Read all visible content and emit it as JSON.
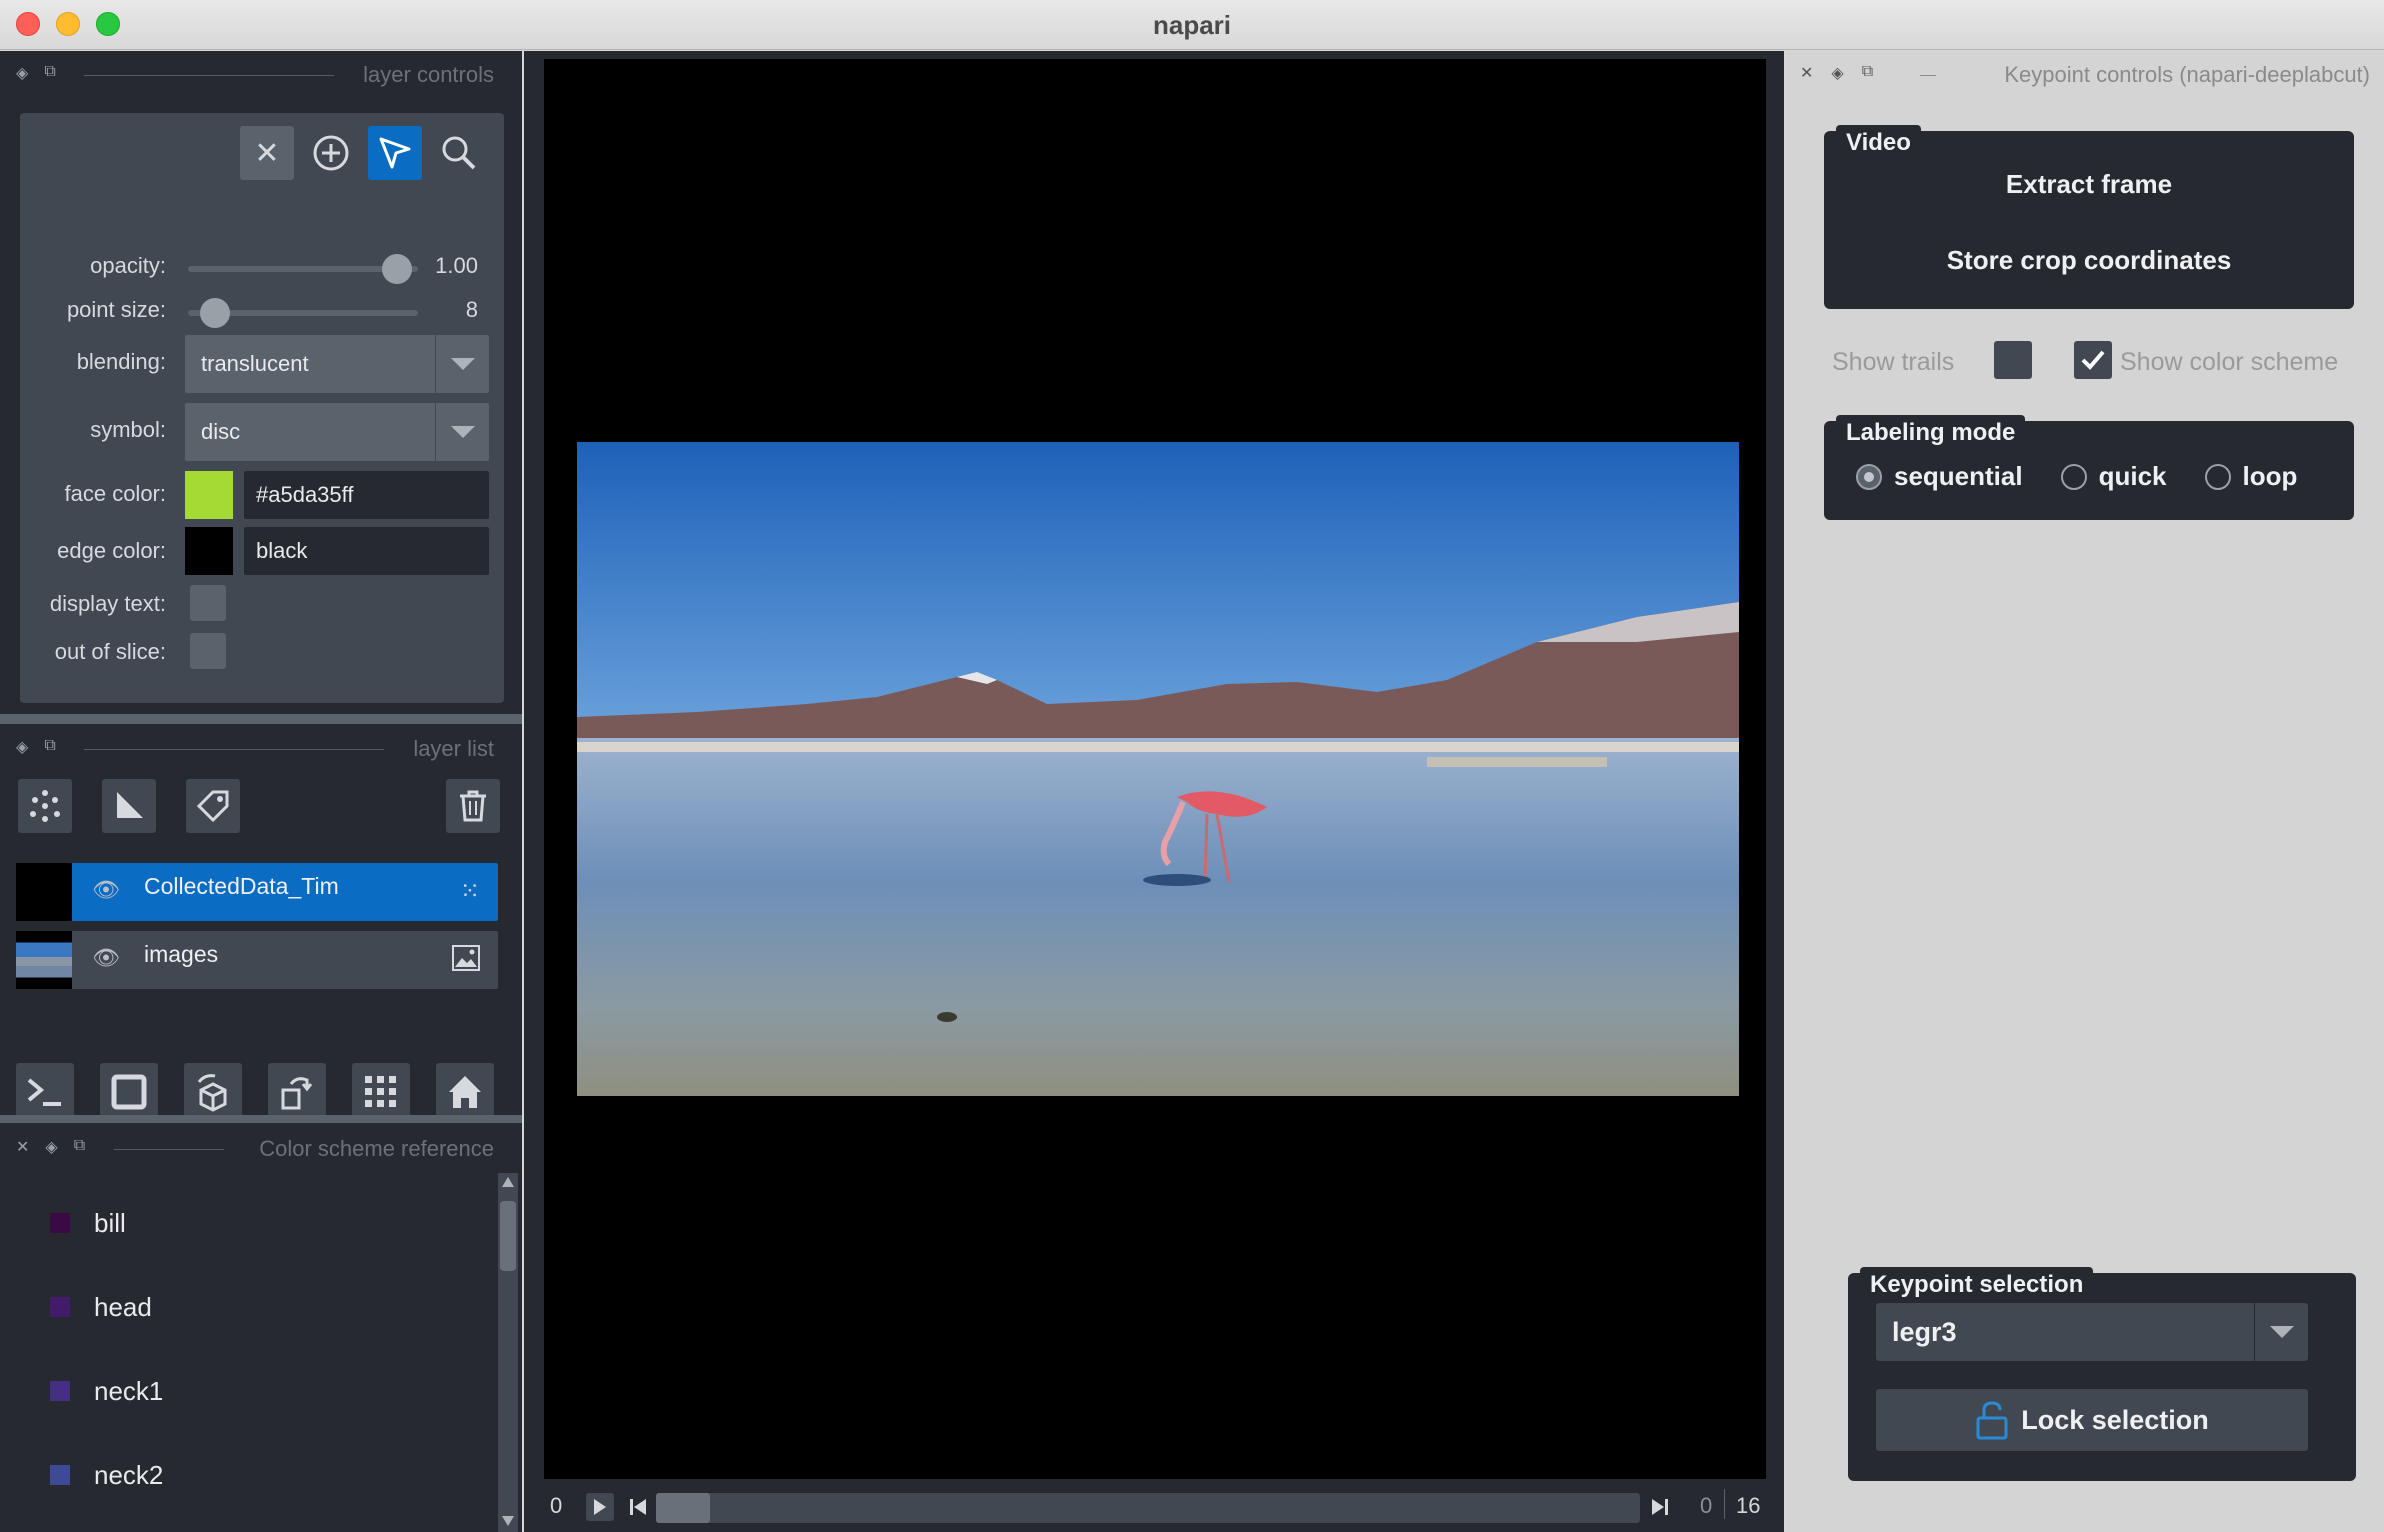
{
  "app": {
    "title": "napari"
  },
  "layer_controls": {
    "header": "layer controls",
    "opacity": {
      "label": "opacity:",
      "value": "1.00",
      "fraction": 1.0
    },
    "point_size": {
      "label": "point size:",
      "value": "8",
      "fraction": 0.1
    },
    "blending": {
      "label": "blending:",
      "value": "translucent"
    },
    "symbol": {
      "label": "symbol:",
      "value": "disc"
    },
    "face_color": {
      "label": "face color:",
      "value": "#a5da35ff",
      "swatch": "#a5da35"
    },
    "edge_color": {
      "label": "edge color:",
      "value": "black",
      "swatch": "#000000"
    },
    "display_text": {
      "label": "display text:"
    },
    "out_of_slice": {
      "label": "out of slice:"
    }
  },
  "layer_list": {
    "header": "layer list",
    "layers": [
      {
        "name": "CollectedData_Tim",
        "type_icon": "points-icon",
        "selected": true
      },
      {
        "name": "images",
        "type_icon": "image-icon",
        "selected": false
      }
    ]
  },
  "color_scheme": {
    "header": "Color scheme reference",
    "items": [
      {
        "name": "bill",
        "color": "#3b0a45"
      },
      {
        "name": "head",
        "color": "#421c6b"
      },
      {
        "name": "neck1",
        "color": "#452f85"
      },
      {
        "name": "neck2",
        "color": "#3f4a97"
      }
    ]
  },
  "dims": {
    "current": "0",
    "slider_pos": "0",
    "total": "16"
  },
  "keypoint_controls": {
    "header": "Keypoint controls (napari-deeplabcut)",
    "video": {
      "title": "Video",
      "extract_frame": "Extract frame",
      "store_crop": "Store crop coordinates"
    },
    "show_trails": {
      "label": "Show trails",
      "checked": false
    },
    "show_color_scheme": {
      "label": "Show color scheme",
      "checked": true
    },
    "labeling_mode": {
      "title": "Labeling mode",
      "options": [
        "sequential",
        "quick",
        "loop"
      ],
      "selected": "sequential"
    },
    "keypoint_selection": {
      "title": "Keypoint selection",
      "value": "legr3",
      "lock_label": "Lock selection"
    }
  }
}
